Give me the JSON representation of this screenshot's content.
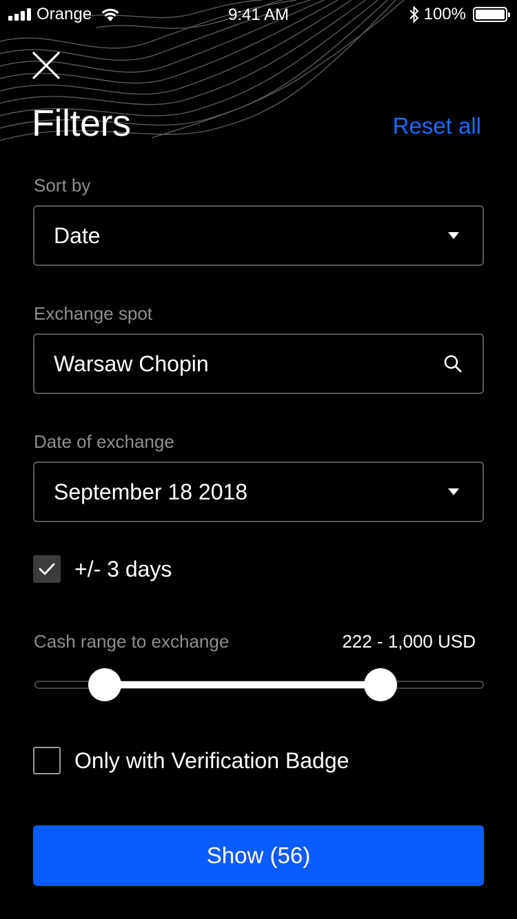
{
  "status_bar": {
    "carrier": "Orange",
    "time": "9:41 AM",
    "battery": "100%",
    "battery_level": 1.0
  },
  "header": {
    "title": "Filters",
    "reset_label": "Reset all"
  },
  "sort": {
    "label": "Sort by",
    "value": "Date"
  },
  "exchange_spot": {
    "label": "Exchange spot",
    "value": "Warsaw Chopin"
  },
  "date": {
    "label": "Date of exchange",
    "value": "September 18 2018"
  },
  "flex_days": {
    "label": "+/- 3 days",
    "checked": true
  },
  "cash_range": {
    "label": "Cash range to exchange",
    "value_text": "222 - 1,000 USD",
    "min": 222,
    "max": 1000,
    "unit": "USD"
  },
  "verification": {
    "label": "Only with Verification Badge",
    "checked": false
  },
  "show_button": {
    "label": "Show (56)"
  },
  "colors": {
    "accent": "#0a5cff",
    "link": "#1a6bff",
    "background": "#000000",
    "muted_text": "#8e8e8e"
  }
}
